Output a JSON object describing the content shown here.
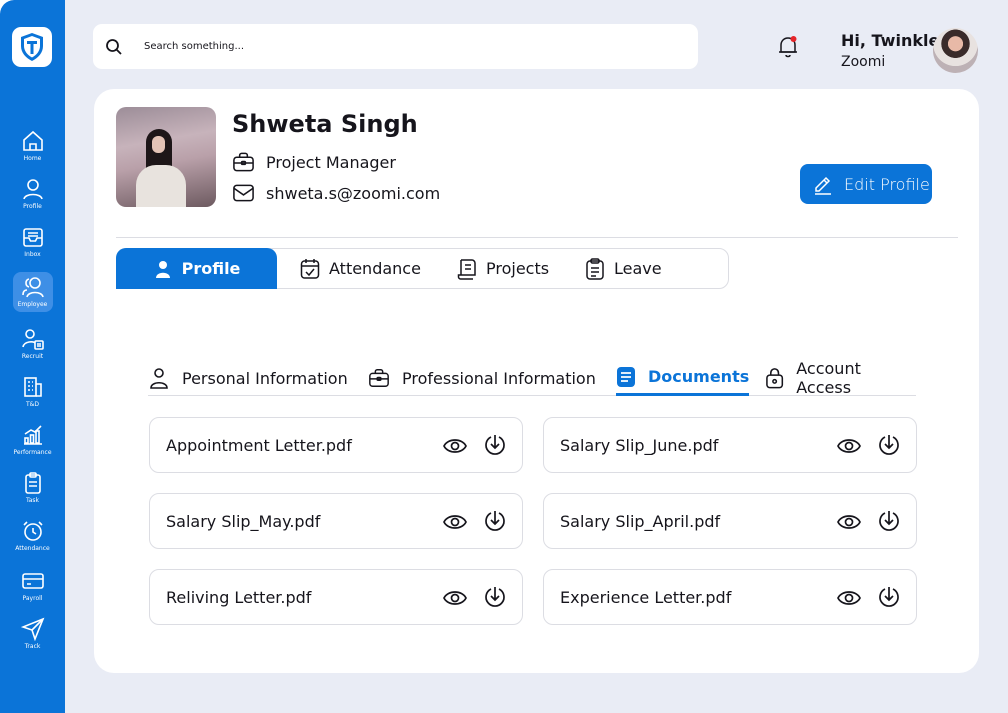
{
  "app": {
    "logo_icon": "brand-shield-logo",
    "accent": "#0b74d8",
    "background": "#e9ecf5"
  },
  "sidebar": {
    "items": [
      {
        "label": "Home",
        "icon": "home-icon"
      },
      {
        "label": "Profile",
        "icon": "user-icon"
      },
      {
        "label": "Inbox",
        "icon": "inbox-icon"
      },
      {
        "label": "Employee",
        "icon": "users-icon",
        "active": true
      },
      {
        "label": "Recruit",
        "icon": "recruit-icon"
      },
      {
        "label": "T&D",
        "icon": "building-icon"
      },
      {
        "label": "Performance",
        "icon": "chart-icon"
      },
      {
        "label": "Task",
        "icon": "clipboard-icon"
      },
      {
        "label": "Attendance",
        "icon": "alarm-icon"
      },
      {
        "label": "Payroll",
        "icon": "card-icon"
      },
      {
        "label": "Track",
        "icon": "send-icon"
      }
    ]
  },
  "topbar": {
    "search_placeholder": "Search something...",
    "greeting": "Hi, Twinkle",
    "company": "Zoomi",
    "notification_dot_color": "#e5252a"
  },
  "profile": {
    "name": "Shweta Singh",
    "role": "Project Manager",
    "email": "shweta.s@zoomi.com",
    "edit_label": "Edit Profile"
  },
  "tabs": [
    {
      "label": "Profile",
      "active": true
    },
    {
      "label": "Attendance"
    },
    {
      "label": "Projects"
    },
    {
      "label": "Leave"
    }
  ],
  "subtabs": [
    {
      "label": "Personal Information"
    },
    {
      "label": "Professional Information"
    },
    {
      "label": "Documents",
      "active": true
    },
    {
      "label": "Account Access"
    }
  ],
  "documents": [
    {
      "name": "Appointment Letter.pdf"
    },
    {
      "name": "Salary Slip_June.pdf"
    },
    {
      "name": "Salary Slip_May.pdf"
    },
    {
      "name": "Salary Slip_April.pdf"
    },
    {
      "name": "Reliving Letter.pdf"
    },
    {
      "name": "Experience Letter.pdf"
    }
  ]
}
